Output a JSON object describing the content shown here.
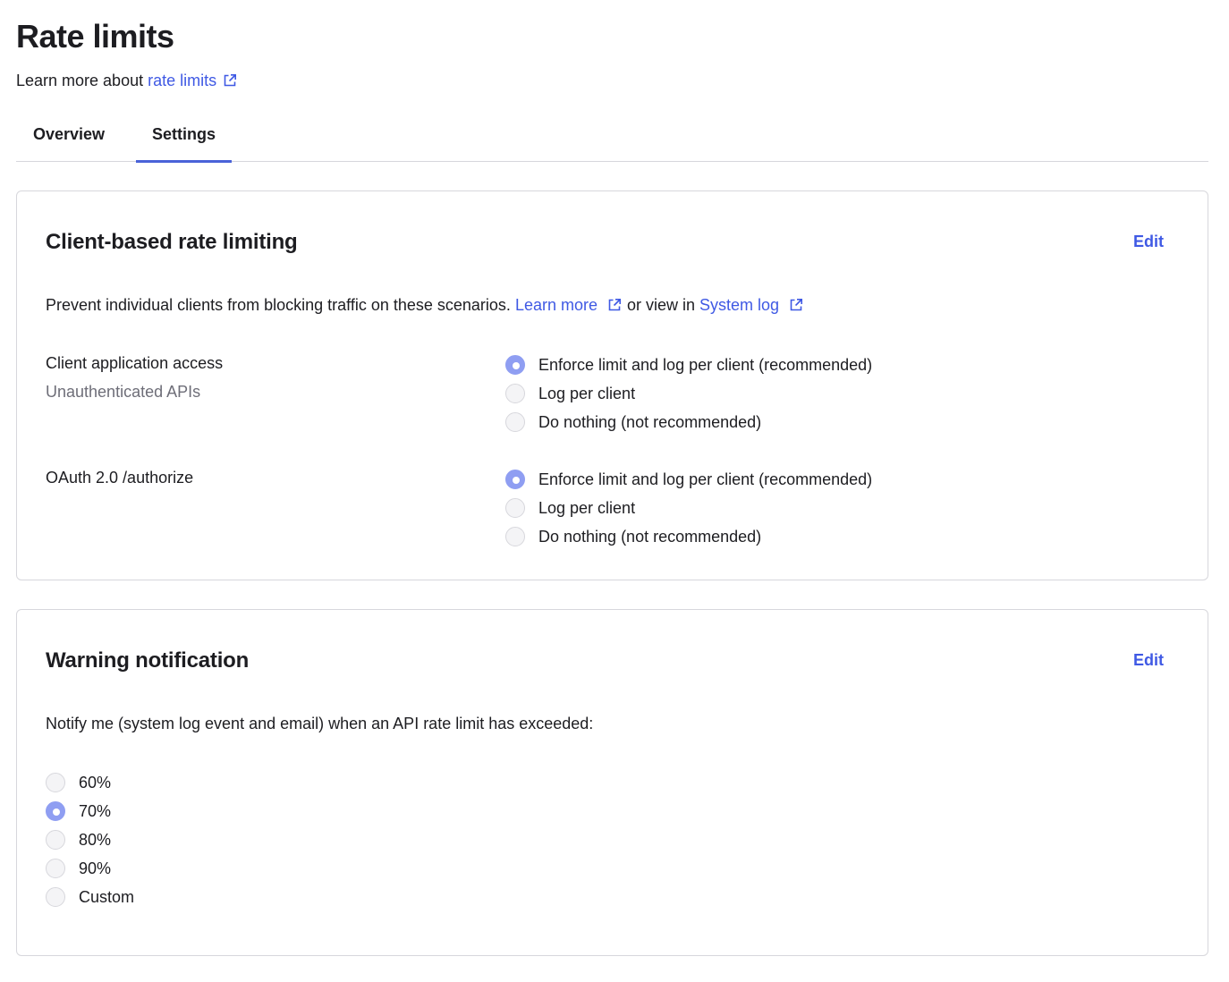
{
  "header": {
    "title": "Rate limits",
    "learn_prefix": "Learn more about ",
    "learn_link": "rate limits"
  },
  "tabs": [
    {
      "label": "Overview",
      "active": false
    },
    {
      "label": "Settings",
      "active": true
    }
  ],
  "client_card": {
    "title": "Client-based rate limiting",
    "edit_label": "Edit",
    "desc_prefix": "Prevent individual clients from blocking traffic on these scenarios. ",
    "learn_more": "Learn more",
    "desc_middle": " or view in ",
    "system_log": "System log",
    "sections": [
      {
        "label": "Client application access",
        "sublabel": "Unauthenticated APIs",
        "options": [
          {
            "label": "Enforce limit and log per client (recommended)",
            "checked": true
          },
          {
            "label": "Log per client",
            "checked": false
          },
          {
            "label": "Do nothing (not recommended)",
            "checked": false
          }
        ]
      },
      {
        "label": "OAuth 2.0 /authorize",
        "sublabel": "",
        "options": [
          {
            "label": "Enforce limit and log per client (recommended)",
            "checked": true
          },
          {
            "label": "Log per client",
            "checked": false
          },
          {
            "label": "Do nothing (not recommended)",
            "checked": false
          }
        ]
      }
    ]
  },
  "warning_card": {
    "title": "Warning notification",
    "edit_label": "Edit",
    "desc": "Notify me (system log event and email) when an API rate limit has exceeded:",
    "options": [
      {
        "label": "60%",
        "checked": false
      },
      {
        "label": "70%",
        "checked": true
      },
      {
        "label": "80%",
        "checked": false
      },
      {
        "label": "90%",
        "checked": false
      },
      {
        "label": "Custom",
        "checked": false
      }
    ]
  },
  "colors": {
    "link": "#3f59e4",
    "tab_underline": "#4a62d8",
    "radio_checked": "#8f9ef2",
    "border": "#d7d7dc",
    "muted_text": "#6e6e78"
  },
  "icons": {
    "external_link": "external-link-icon"
  }
}
